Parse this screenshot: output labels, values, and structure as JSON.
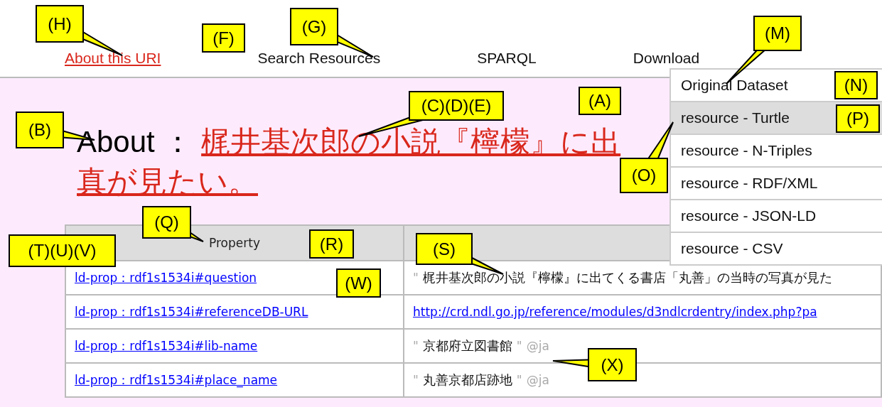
{
  "nav": [
    {
      "label": "About this URI",
      "selected": true
    },
    {
      "label": "Search Resources",
      "selected": false
    },
    {
      "label": "SPARQL",
      "selected": false
    },
    {
      "label": "Download",
      "selected": false
    }
  ],
  "download_menu": [
    {
      "label": "Original Dataset",
      "selected": false
    },
    {
      "label": "resource - Turtle",
      "selected": true
    },
    {
      "label": "resource - N-Triples",
      "selected": false
    },
    {
      "label": "resource - RDF/XML",
      "selected": false
    },
    {
      "label": "resource - JSON-LD",
      "selected": false
    },
    {
      "label": "resource - CSV",
      "selected": false
    }
  ],
  "heading": {
    "prefix": "About",
    "separator": "：",
    "link_lines": [
      "梶井基次郎の小説『檸檬』に出",
      "真が見たい。"
    ]
  },
  "table": {
    "columns": [
      "Property"
    ],
    "rows": [
      {
        "property": "ld-prop：rdf1s1534i#question",
        "value": {
          "kind": "literal",
          "open_quote": "\"",
          "text": "梶井基次郎の小説『檸檬』に出てくる書店「丸善」の当時の写真が見た"
        }
      },
      {
        "property": "ld-prop：rdf1s1534i#referenceDB-URL",
        "value": {
          "kind": "link",
          "text": "http://crd.ndl.go.jp/reference/modules/d3ndlcrdentry/index.php?pa"
        }
      },
      {
        "property": "ld-prop：rdf1s1534i#lib-name",
        "value": {
          "kind": "literal",
          "open_quote": "\"",
          "text": "京都府立図書館",
          "close_quote": "\"",
          "lang": "@ja"
        }
      },
      {
        "property": "ld-prop：rdf1s1534i#place_name",
        "value": {
          "kind": "literal",
          "open_quote": "\"",
          "text": "丸善京都店跡地",
          "close_quote": "\"",
          "lang": "@ja"
        }
      }
    ]
  },
  "annotations": [
    {
      "label": "(H)"
    },
    {
      "label": "(G)"
    },
    {
      "label": "(F)"
    },
    {
      "label": "(M)"
    },
    {
      "label": "(N)"
    },
    {
      "label": "(A)"
    },
    {
      "label": "(C)(D)(E)"
    },
    {
      "label": "(P)"
    },
    {
      "label": "(B)"
    },
    {
      "label": "(O)"
    },
    {
      "label": "(Q)"
    },
    {
      "label": "(T)(U)(V)"
    },
    {
      "label": "(R)"
    },
    {
      "label": "(S)"
    },
    {
      "label": "(W)"
    },
    {
      "label": "(X)"
    }
  ]
}
